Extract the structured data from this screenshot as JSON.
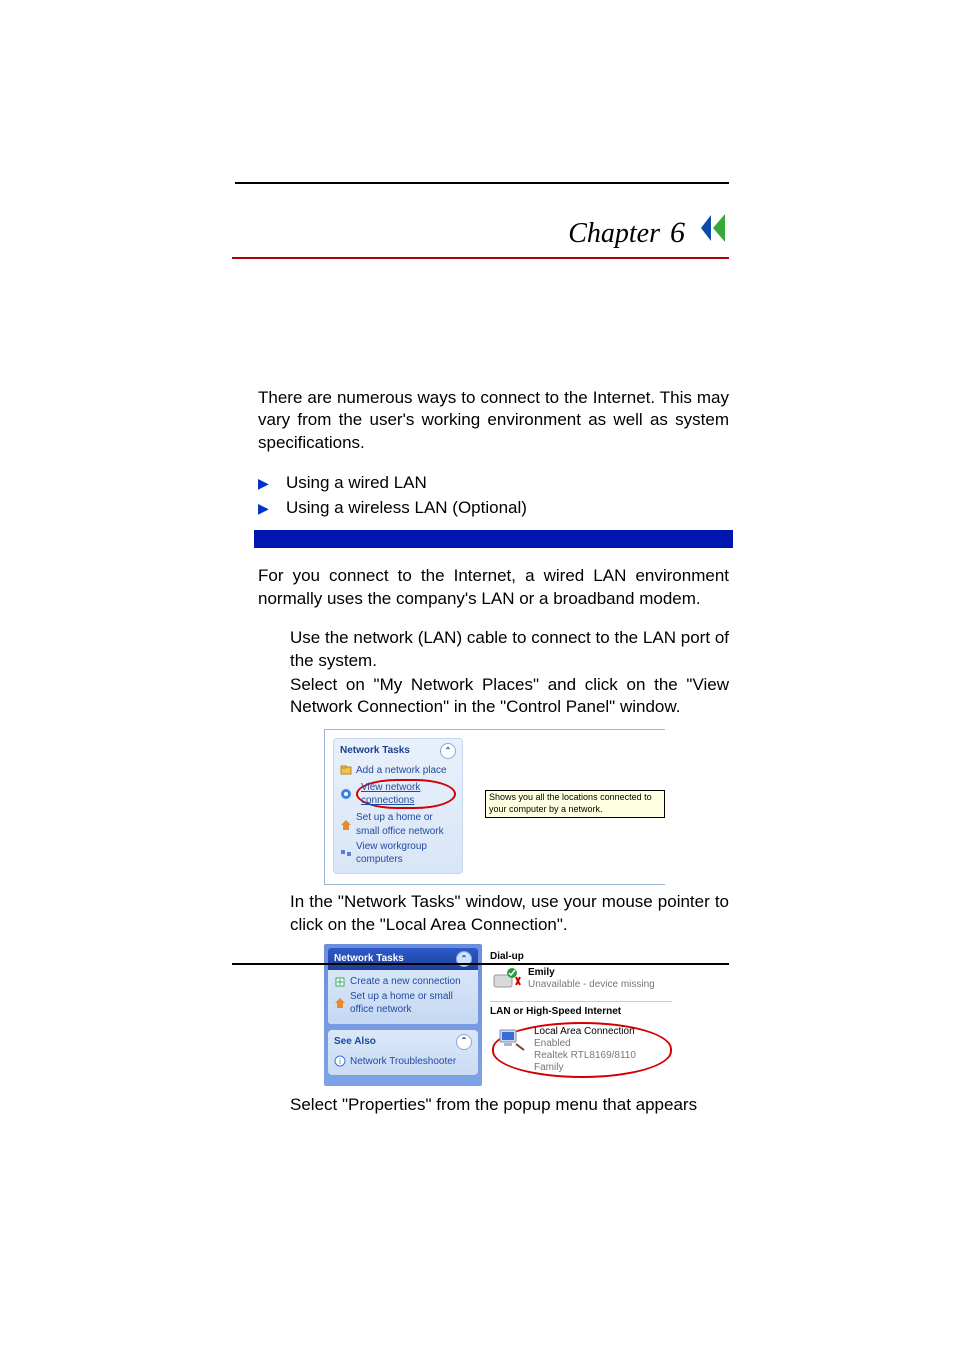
{
  "chapter": {
    "word": "Chapter",
    "number": "6"
  },
  "intro": "There are numerous ways to connect to the Internet. This may vary from the user's working environment as well as system specifications.",
  "bullets": [
    "Using a wired LAN",
    "Using a wireless LAN (Optional)"
  ],
  "wired_intro": "For you connect to the Internet, a wired LAN environment normally uses the company's LAN or a broadband modem.",
  "step1": "Use the network (LAN) cable to connect to the LAN port of the system.",
  "step2": "Select on \"My Network Places\" and click on the \"View Network Connection\" in the \"Control Panel\" window.",
  "step3": "In the \"Network Tasks\" window, use your mouse pointer to click on the \"Local Area Connection\".",
  "step4": "Select \"Properties\" from the popup menu that appears",
  "ss1": {
    "panel_title": "Network Tasks",
    "links": [
      "Add a network place",
      "View network connections",
      "Set up a home or small office network",
      "View workgroup computers"
    ],
    "tooltip": "Shows you all the locations connected to your computer by a network."
  },
  "ss2": {
    "panel1_title": "Network Tasks",
    "panel1_links": [
      "Create a new connection",
      "Set up a home or small office network"
    ],
    "panel2_title": "See Also",
    "panel2_links": [
      "Network Troubleshooter"
    ],
    "right": {
      "section1": "Dial-up",
      "conn1": {
        "name": "Emily",
        "status": "Unavailable - device missing"
      },
      "section2": "LAN or High-Speed Internet",
      "conn2": {
        "name": "Local Area Connection",
        "status": "Enabled",
        "device": "Realtek RTL8169/8110 Family"
      }
    }
  }
}
